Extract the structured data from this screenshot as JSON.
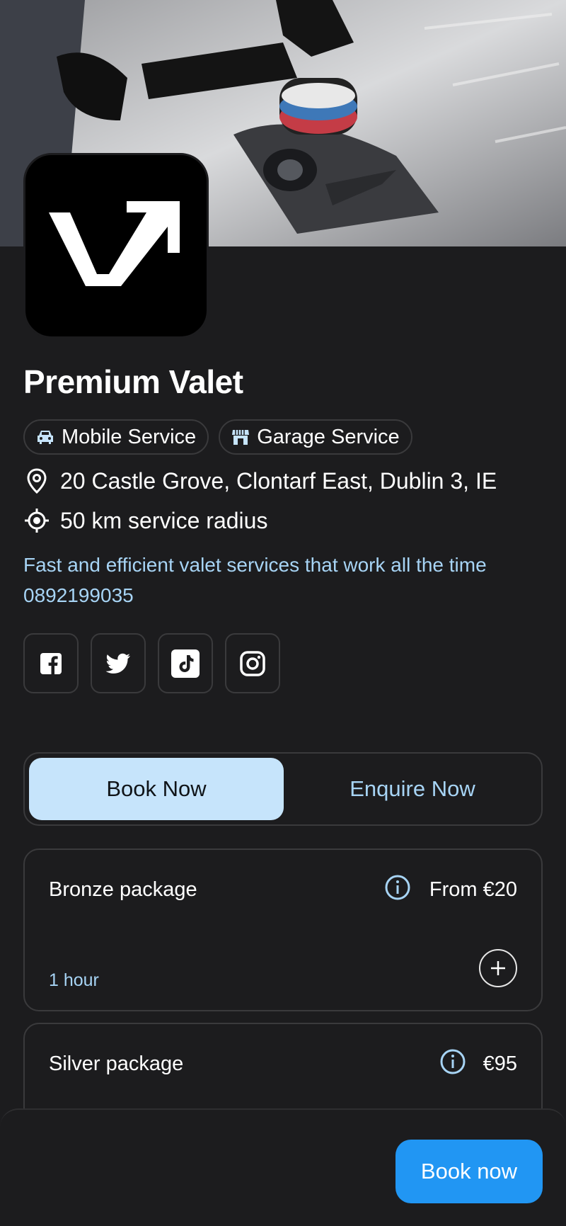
{
  "business": {
    "name": "Premium Valet",
    "address": "20 Castle Grove, Clontarf East, Dublin 3, IE",
    "radius": "50 km service radius",
    "description": "Fast and efficient valet services that work all the time",
    "phone": "0892199035"
  },
  "chips": [
    {
      "label": "Mobile Service",
      "icon": "car-icon"
    },
    {
      "label": "Garage Service",
      "icon": "store-icon"
    }
  ],
  "socials": [
    "facebook-icon",
    "twitter-icon",
    "tiktok-icon",
    "instagram-icon"
  ],
  "tabs": {
    "book": "Book Now",
    "enquire": "Enquire Now",
    "active": "book"
  },
  "packages": [
    {
      "name": "Bronze package",
      "price": "From €20",
      "duration": "1 hour"
    },
    {
      "name": "Silver package",
      "price": "€95"
    }
  ],
  "footer": {
    "book_label": "Book now"
  },
  "colors": {
    "background": "#1c1c1e",
    "accent": "#2196f3",
    "active_tab": "#c6e4fb",
    "link_text": "#a7d4f5"
  }
}
